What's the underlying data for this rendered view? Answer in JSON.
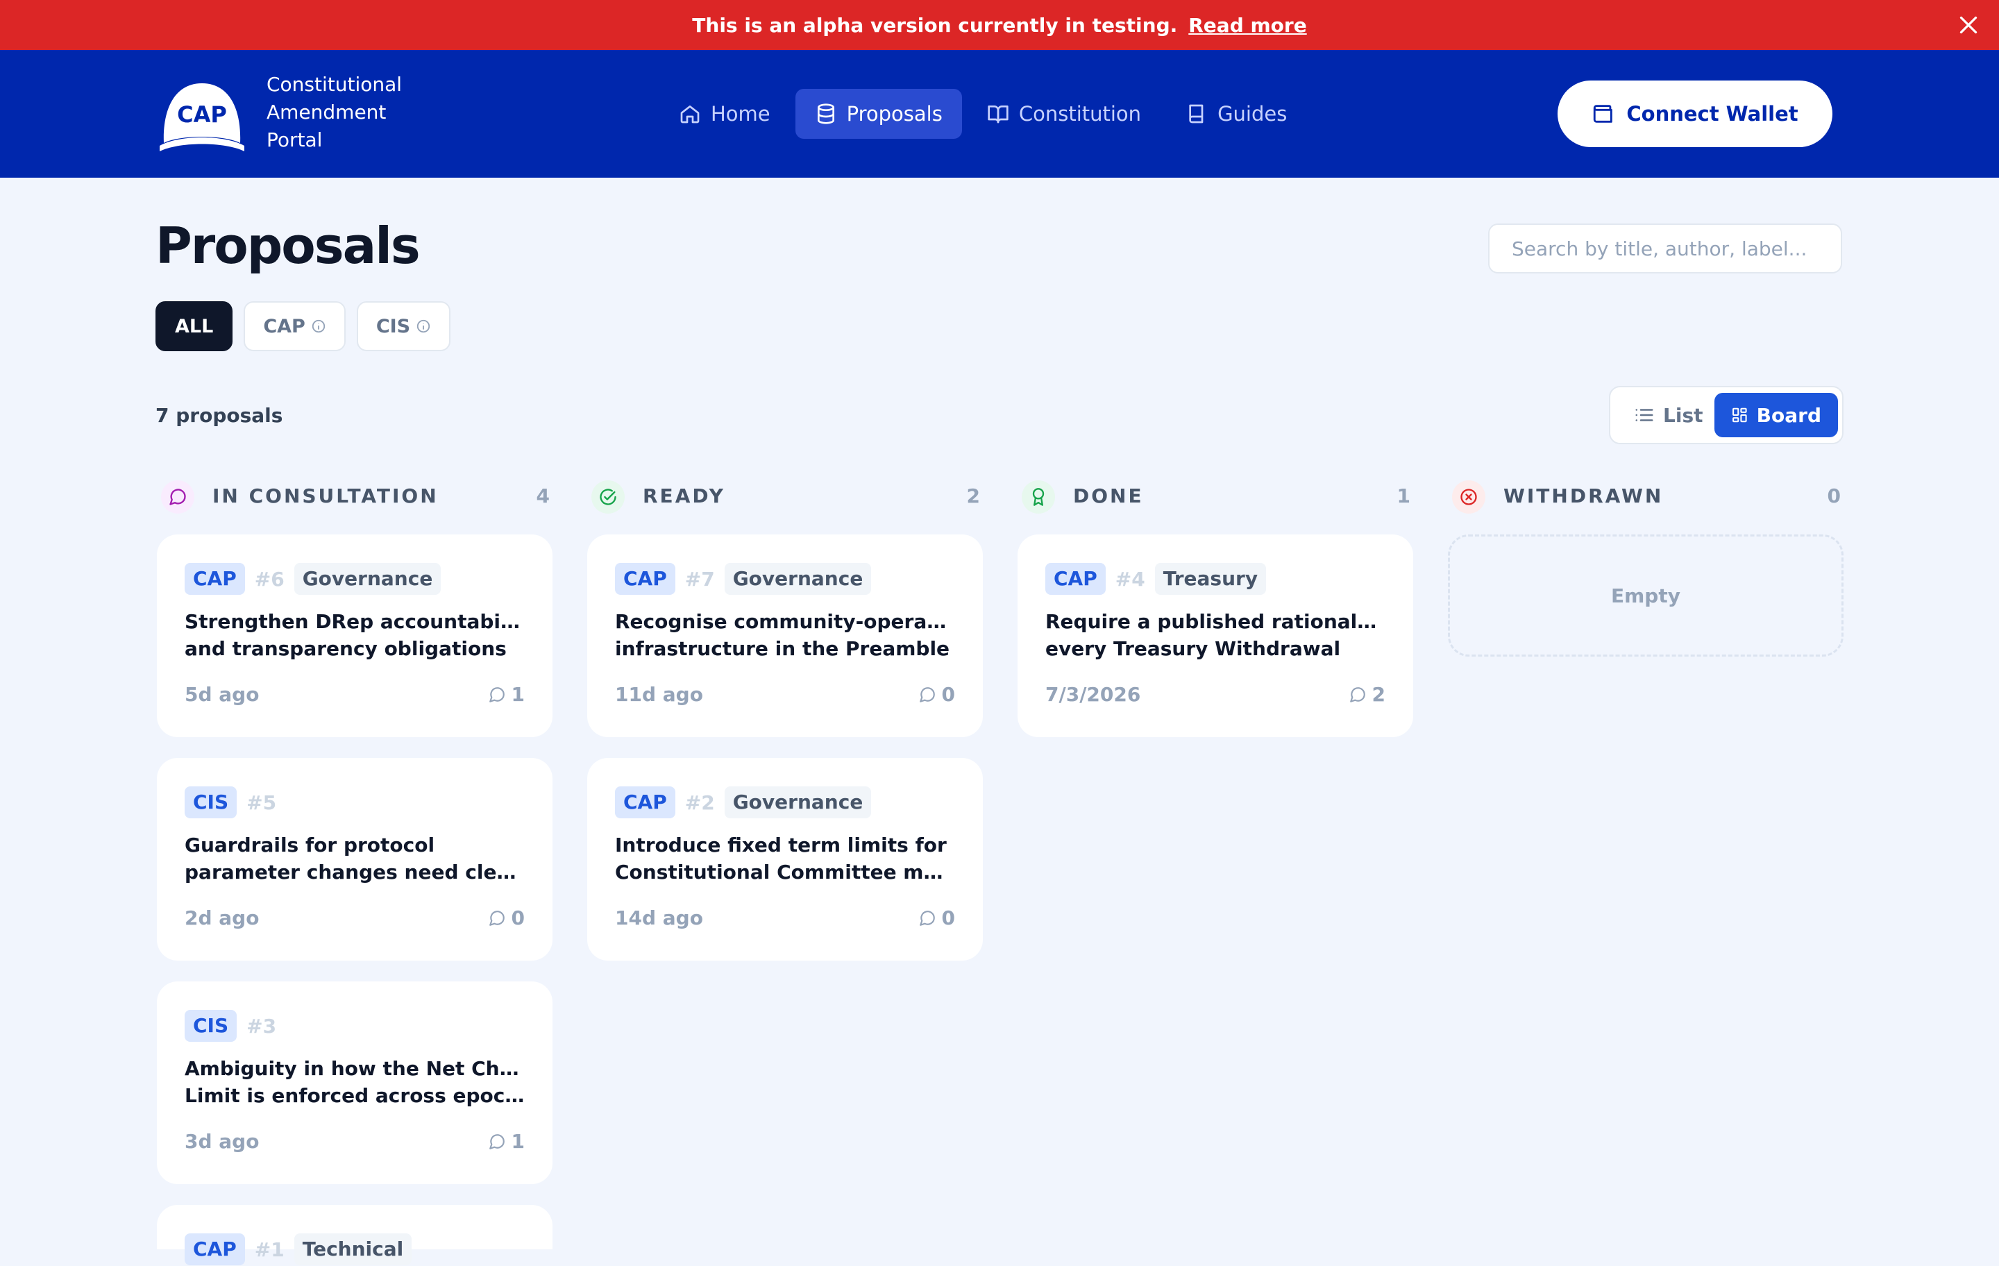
{
  "banner": {
    "text": "This is an alpha version currently in testing.",
    "link": "Read more"
  },
  "header": {
    "logo_text": "CAP",
    "app_name_lines": [
      "Constitutional",
      "Amendment",
      "Portal"
    ],
    "nav": [
      {
        "label": "Home",
        "icon": "home-icon",
        "active": false
      },
      {
        "label": "Proposals",
        "icon": "database-icon",
        "active": true
      },
      {
        "label": "Constitution",
        "icon": "book-open-icon",
        "active": false
      },
      {
        "label": "Guides",
        "icon": "book-icon",
        "active": false
      }
    ],
    "wallet_button": "Connect Wallet"
  },
  "page": {
    "title": "Proposals",
    "search_placeholder": "Search by title, author, label...",
    "filters": [
      {
        "label": "ALL",
        "active": true
      },
      {
        "label": "CAP",
        "info_icon": true
      },
      {
        "label": "CIS",
        "info_icon": true
      }
    ],
    "count": "7 proposals",
    "view_toggle": {
      "list": "List",
      "board": "Board",
      "selected": "Board"
    }
  },
  "colors": {
    "banner": "#dc2626",
    "header": "#0027ad",
    "accent": "#1d56db",
    "background": "#f1f5fd"
  },
  "columns": [
    {
      "title": "IN CONSULTATION",
      "count": "4",
      "icon": "chat-bubble-icon",
      "cards": [
        {
          "type": "CAP",
          "num": "#6",
          "label": "Governance",
          "title": [
            "Strengthen DRep accountability",
            "and transparency obligations"
          ],
          "date": "5d ago",
          "comments": "1"
        },
        {
          "type": "CIS",
          "num": "#5",
          "label": "",
          "title": [
            "Guardrails for protocol",
            "parameter changes need clearer criteria"
          ],
          "date": "2d ago",
          "comments": "0"
        },
        {
          "type": "CIS",
          "num": "#3",
          "label": "",
          "title": [
            "Ambiguity in how the Net Change",
            "Limit is enforced across epochs"
          ],
          "date": "3d ago",
          "comments": "1"
        },
        {
          "type": "CAP",
          "num": "#1",
          "label": "Technical",
          "title": [
            "",
            ""
          ],
          "date": "",
          "comments": ""
        }
      ]
    },
    {
      "title": "READY",
      "count": "2",
      "icon": "check-circle-icon",
      "cards": [
        {
          "type": "CAP",
          "num": "#7",
          "label": "Governance",
          "title": [
            "Recognise community-operated",
            "infrastructure in the Preamble"
          ],
          "date": "11d ago",
          "comments": "0"
        },
        {
          "type": "CAP",
          "num": "#2",
          "label": "Governance",
          "title": [
            "Introduce fixed term limits for",
            "Constitutional Committee members"
          ],
          "date": "14d ago",
          "comments": "0"
        }
      ]
    },
    {
      "title": "DONE",
      "count": "1",
      "icon": "award-icon",
      "cards": [
        {
          "type": "CAP",
          "num": "#4",
          "label": "Treasury",
          "title": [
            "Require a published rationale for",
            "every Treasury Withdrawal"
          ],
          "date": "7/3/2026",
          "comments": "2"
        }
      ]
    },
    {
      "title": "WITHDRAWN",
      "count": "0",
      "icon": "x-circle-icon",
      "cards": [],
      "empty_text": "Empty"
    }
  ]
}
